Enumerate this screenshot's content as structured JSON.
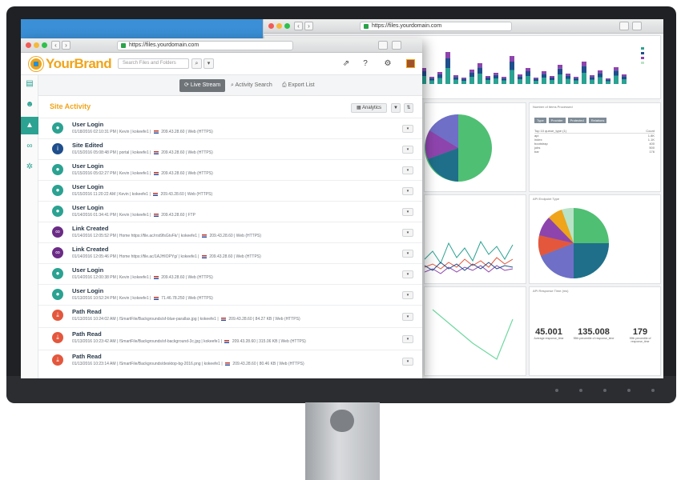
{
  "back_window": {
    "url": "https://files.yourdomain.com",
    "panels": [
      {
        "title": "Number of Items Processed"
      },
      {
        "title": "API Endpoint Type"
      },
      {
        "title": "API Response Time (ms)"
      }
    ],
    "filter_buttons": [
      "Type",
      "Provider",
      "Protected",
      "Relations"
    ],
    "table_head": [
      "Top 10 queue_type (1)",
      "Count"
    ],
    "table_rows": [
      [
        "api",
        "1.8K"
      ],
      [
        "index",
        "1.1K"
      ],
      [
        "bootstrap",
        "400"
      ],
      [
        "jobs",
        "500"
      ],
      [
        "bar",
        "176"
      ]
    ],
    "stats": [
      {
        "value": "45.001",
        "label": "Average response_time"
      },
      {
        "value": "135.008",
        "label": "95th percentile of response_time"
      },
      {
        "value": "179",
        "label": "99th percentile of response_time"
      }
    ]
  },
  "front_window": {
    "url": "https://files.yourdomain.com",
    "brand": "YourBrand",
    "search_placeholder": "Search Files and Folders",
    "tabs": [
      "Live Stream",
      "Activity Search",
      "Export List"
    ],
    "section_title": "Site Activity",
    "analytics_label": "Analytics",
    "rows": [
      {
        "title": "User Login",
        "meta": "01/18/2016 02:10:31 PM  |  Kevin  |  kokeefe1  |  [flag]  209.43.28.60  |  Web (HTTPS)",
        "icon": "user",
        "color": "#2ba292"
      },
      {
        "title": "Site Edited",
        "meta": "01/15/2016 05:08:48 PM  |  portal  |  kokeefe1  |  [flag]  209.43.28.60  |  Web (HTTPS)",
        "icon": "info",
        "color": "#1f4e8c"
      },
      {
        "title": "User Login",
        "meta": "01/15/2016 05:02:27 PM  |  Kevin  |  kokeefe1  |  [flag]  209.43.28.60  |  Web (HTTPS)",
        "icon": "user",
        "color": "#2ba292"
      },
      {
        "title": "User Login",
        "meta": "01/15/2016 11:20:22 AM  |  Kevin  |  kokeefe1  |  [flag]  209.43.28.60  |  Web (HTTPS)",
        "icon": "user",
        "color": "#2ba292"
      },
      {
        "title": "User Login",
        "meta": "01/14/2016 01:34:41 PM  |  Kevin  |  kokeefe1  |  [flag]  209.43.28.60  |  FTP",
        "icon": "user",
        "color": "#2ba292"
      },
      {
        "title": "Link Created",
        "meta": "01/14/2016 12:05:52 PM  |  Home https://file.ac/rrst9fsGtvFk/  |  kokeefe1  |  [flag]  209.43.28.60  |  Web (HTTPS)",
        "icon": "link",
        "color": "#6b2b86"
      },
      {
        "title": "Link Created",
        "meta": "01/14/2016 12:05:46 PM  |  Home https://file.ac/1AJHIOPYg/  |  kokeefe1  |  [flag]  209.43.28.60  |  Web (HTTPS)",
        "icon": "link",
        "color": "#6b2b86"
      },
      {
        "title": "User Login",
        "meta": "01/14/2016 12:00:38 PM  |  Kevin  |  kokeefe1  |  [flag]  209.43.28.60  |  Web (HTTPS)",
        "icon": "user",
        "color": "#2ba292"
      },
      {
        "title": "User Login",
        "meta": "01/13/2016 10:52:24 PM  |  Kevin  |  kokeefe1  |  [flag]  71.46.78.250  |  Web (HTTPS)",
        "icon": "user",
        "color": "#2ba292"
      },
      {
        "title": "Path Read",
        "meta": "01/13/2016 10:24:02 AM  |  /SmartFile/Backgrounds/sf-blue-parallax.jpg  |  kokeefe1  |  [flag]  209.43.28.60  |  84.27 KB  |  Web (HTTPS)",
        "icon": "download",
        "color": "#e4573d"
      },
      {
        "title": "Path Read",
        "meta": "01/13/2016 10:23:42 AM  |  /SmartFile/Backgrounds/sf-background-3c.jpg  |  kokeefe1  |  [flag]  209.43.28.60  |  315.06 KB  |  Web (HTTPS)",
        "icon": "download",
        "color": "#e4573d"
      },
      {
        "title": "Path Read",
        "meta": "01/13/2016 10:23:14 AM  |  /SmartFile/Backgrounds/desktop-bg-2016.png  |  kokeefe1  |  [flag]  209.43.28.60  |  80.46 KB  |  Web (HTTPS)",
        "icon": "download",
        "color": "#e4573d"
      }
    ]
  }
}
